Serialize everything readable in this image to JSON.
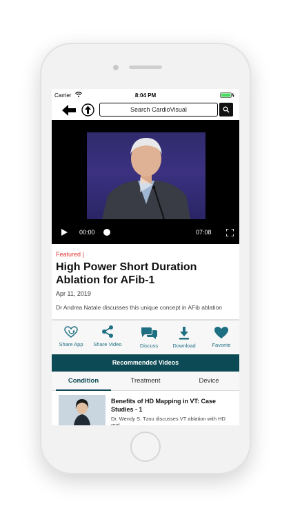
{
  "status_bar": {
    "carrier": "Carrier",
    "time": "8:04 PM"
  },
  "nav": {
    "search_placeholder": "Search CardioVisual"
  },
  "video": {
    "elapsed": "00:00",
    "duration": "07:08",
    "progress": 0
  },
  "article": {
    "category": "Featured |",
    "title": "High Power Short Duration Ablation for AFib-1",
    "date": "Apr 11, 2019",
    "summary": "Dr Andrea Natale discusses this unique concept in AFib ablation"
  },
  "actions": [
    {
      "label": "Share App",
      "icon": "heart-stethoscope-icon"
    },
    {
      "label": "Share Video",
      "icon": "share-icon"
    },
    {
      "label": "Discuss",
      "icon": "chat-bubbles-icon"
    },
    {
      "label": "Download",
      "icon": "download-icon"
    },
    {
      "label": "Favorite",
      "icon": "heart-icon"
    }
  ],
  "recommended": {
    "heading": "Recommended Videos",
    "tabs": [
      "Condition",
      "Treatment",
      "Device"
    ],
    "active_tab": "Condition",
    "items": [
      {
        "title": "Benefits of HD Mapping in VT: Case Studies - 1",
        "description": "Dr. Wendy S. Tzou discusses VT ablation with HD grid"
      }
    ]
  },
  "colors": {
    "accent": "#1f6f83",
    "banner": "#0c4a55",
    "featured": "#e03b36"
  }
}
